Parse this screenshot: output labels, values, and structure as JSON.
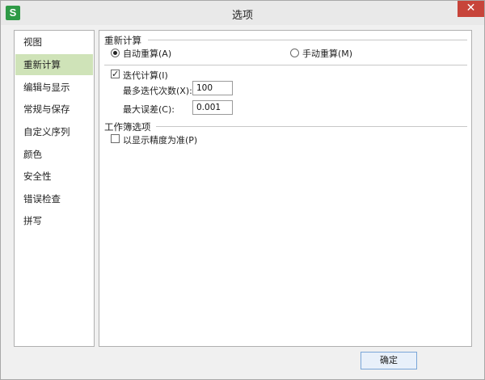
{
  "window": {
    "title": "选项",
    "app_icon": "S",
    "close_label": "✕"
  },
  "sidebar": {
    "items": [
      {
        "label": "视图"
      },
      {
        "label": "重新计算"
      },
      {
        "label": "编辑与显示"
      },
      {
        "label": "常规与保存"
      },
      {
        "label": "自定义序列"
      },
      {
        "label": "颜色"
      },
      {
        "label": "安全性"
      },
      {
        "label": "错误检查"
      },
      {
        "label": "拼写"
      }
    ],
    "active_index": 1
  },
  "recalc": {
    "section_title": "重新计算",
    "auto_label": "自动重算(A)",
    "manual_label": "手动重算(M)",
    "selected": "auto",
    "iterate_label": "迭代计算(I)",
    "iterate_checked": true,
    "max_iter_label": "最多迭代次数(X):",
    "max_iter_value": "100",
    "max_change_label": "最大误差(C):",
    "max_change_value": "0.001"
  },
  "workbook": {
    "section_title": "工作簿选项",
    "precision_label": "以显示精度为准(P)",
    "precision_checked": false
  },
  "footer": {
    "ok_label": "确定"
  }
}
